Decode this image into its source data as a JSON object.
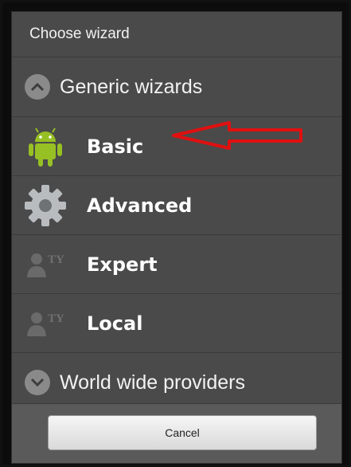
{
  "dialog": {
    "title": "Choose wizard",
    "sections": {
      "generic": {
        "label": "Generic wizards",
        "chevron_icon": "chevron-up-icon"
      },
      "worldwide": {
        "label": "World wide providers",
        "chevron_icon": "chevron-down-icon"
      }
    },
    "items": [
      {
        "label": "Basic",
        "icon": "android-icon"
      },
      {
        "label": "Advanced",
        "icon": "gear-icon"
      },
      {
        "label": "Expert",
        "icon": "user-tty-icon"
      },
      {
        "label": "Local",
        "icon": "user-tty-icon"
      }
    ],
    "cancel_label": "Cancel"
  },
  "annotation": {
    "arrow_color": "#e01010",
    "arrow_icon": "red-arrow-left-icon"
  },
  "colors": {
    "dialog_bg": "#4a4a4a",
    "text": "#ffffff",
    "android_green": "#97c024"
  }
}
